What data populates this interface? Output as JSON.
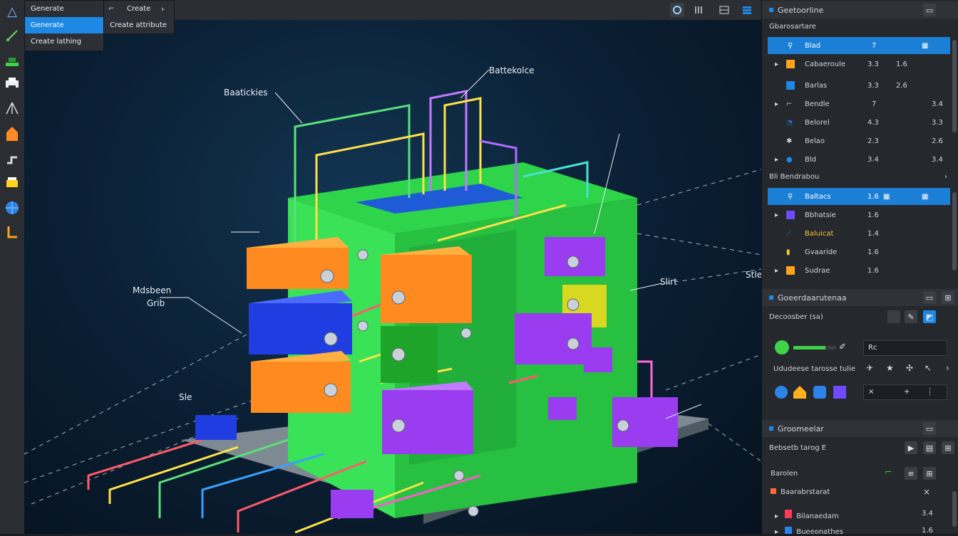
{
  "app": {
    "accent": "#1e88e5",
    "logo_glyph": "△"
  },
  "menu": {
    "items": [
      {
        "label": "Generate"
      },
      {
        "label": "Generate"
      },
      {
        "label": "Create lathing"
      }
    ],
    "submenu": [
      {
        "label": "Create"
      },
      {
        "label": "Create attribute"
      }
    ]
  },
  "topbar": {
    "icons": [
      "view-icon",
      "measure-icon",
      "grid-icon",
      "layers-icon"
    ]
  },
  "viewport": {
    "annotations": [
      {
        "text": "Battekolce"
      },
      {
        "text": "Baatickies"
      },
      {
        "text": "Mdsbeen"
      },
      {
        "text": "Grib"
      },
      {
        "text": "Slirt"
      },
      {
        "text": "Stle"
      },
      {
        "text": "Sle"
      }
    ]
  },
  "outliner": {
    "title": "Geetoorline",
    "section1": "Gbarosartare",
    "rows": [
      {
        "name": "Blad",
        "v1": "7",
        "v2": "",
        "selected": true
      },
      {
        "name": "Cabaeroule",
        "v1": "3.3",
        "v2": "1.6"
      },
      {
        "name": "Barlas",
        "v1": "3.3",
        "v2": "2.6"
      },
      {
        "name": "Bendle",
        "v1": "7",
        "v2": "3.4"
      },
      {
        "name": "Belorel",
        "v1": "4.3",
        "v2": "3.3"
      },
      {
        "name": "Belao",
        "v1": "2.3",
        "v2": "2.6"
      },
      {
        "name": "Bld",
        "v1": "3.4",
        "v2": "3.4"
      }
    ],
    "section2": "Bli Bendrabou",
    "rows2": [
      {
        "name": "Baltacs",
        "v1": "1.6",
        "selected": true
      },
      {
        "name": "Bbhatsie",
        "v1": "1.6"
      },
      {
        "name": "Baluicat",
        "v1": "1.4"
      },
      {
        "name": "Gvaaride",
        "v1": "1.6"
      },
      {
        "name": "Sudrae",
        "v1": "1.6"
      }
    ]
  },
  "properties": {
    "title": "Goeerdaarutenaa",
    "row_label": "Decoosber (sa)",
    "value_field": "Rc",
    "slider_fill": 0.75,
    "transform_label": "Ududeese tarosse tulie",
    "x_label": "×",
    "plus_label": "+"
  },
  "material": {
    "title": "Groomeelar",
    "sub": "Bebsetb tarog E",
    "label1": "Barolen",
    "label2": "Baarabrstarat",
    "row1": "Bilanaedam",
    "row1v": "3.4",
    "row2": "Bueeonathes",
    "row2v": "1.6"
  }
}
